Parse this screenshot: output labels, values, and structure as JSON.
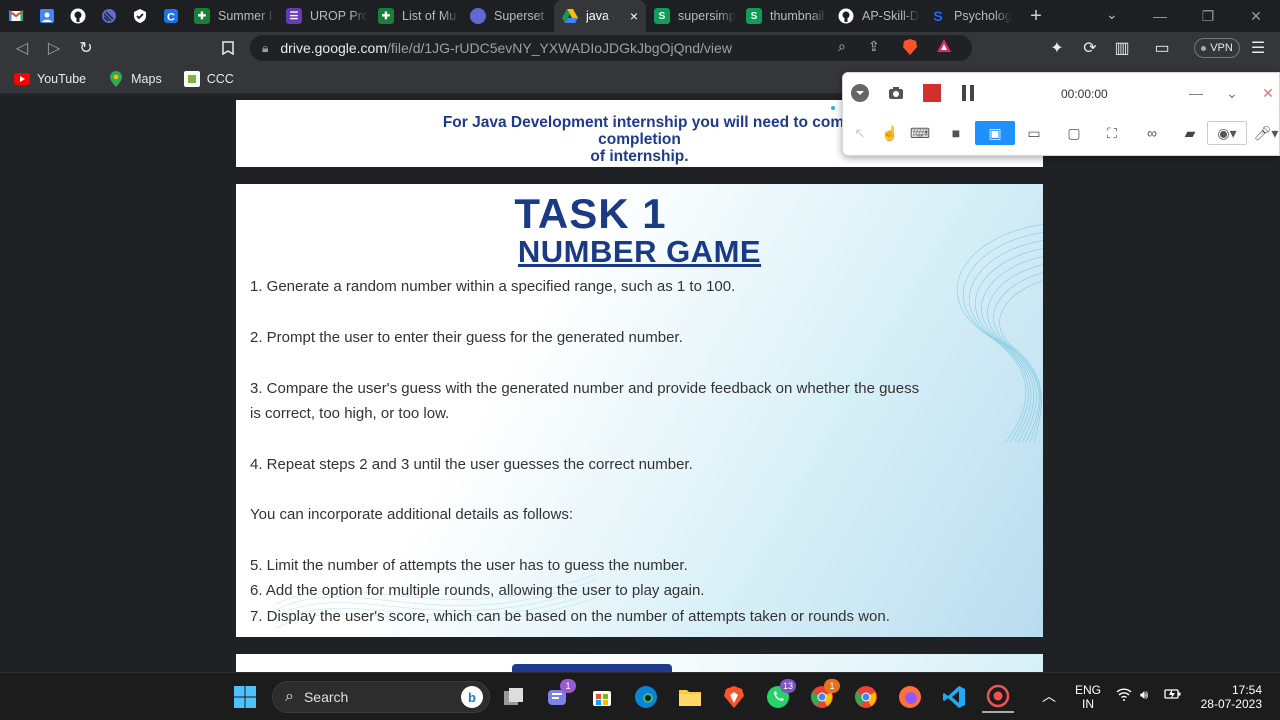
{
  "tabs": {
    "pinned": [
      "gmail-icon",
      "photos-icon",
      "github-icon",
      "linear-icon",
      "check-icon",
      "c-icon"
    ],
    "items": [
      {
        "label": "Summer I",
        "icon": "sheets-icon",
        "color": "#188038"
      },
      {
        "label": "UROP Pro",
        "icon": "forms-icon",
        "color": "#673ab7"
      },
      {
        "label": "List of Mu",
        "icon": "sheets-icon",
        "color": "#188038"
      },
      {
        "label": "Superset",
        "icon": "linear-icon",
        "color": "#5e6ad2"
      },
      {
        "label": "java d",
        "icon": "drive-icon",
        "color": "#fbbc04"
      },
      {
        "label": "supersimp",
        "icon": "s-icon",
        "color": "#0f9d58"
      },
      {
        "label": "thumbnail",
        "icon": "s-icon",
        "color": "#0f9d58"
      },
      {
        "label": "AP-Skill-D",
        "icon": "github-icon",
        "color": "#ffffff"
      },
      {
        "label": "Psycholog",
        "icon": "s-logo-icon",
        "color": "#2962ff"
      }
    ],
    "close_glyph": "×",
    "new_tab_glyph": "+"
  },
  "toolbar": {
    "url_host": "drive.google.com",
    "url_path": "/file/d/1JG-rUDC5evNY_YXWADIoJDGkJbgOjQnd/view",
    "vpn_label": "VPN"
  },
  "bookmarks": [
    {
      "label": "YouTube",
      "icon": "youtube-icon"
    },
    {
      "label": "Maps",
      "icon": "maps-icon"
    },
    {
      "label": "CCC",
      "icon": "ccc-icon"
    }
  ],
  "document": {
    "intro_line1": "For Java Development internship you will need to complete at least 3",
    "intro_line2": "completion",
    "intro_line3": "of internship.",
    "task_title": "TASK 1",
    "task_subtitle": "NUMBER GAME",
    "steps": [
      "1. Generate a random number within a specified range, such as 1 to 100.",
      "2. Prompt the user to enter their guess for the generated number.",
      "3. Compare the user's guess with the generated number and provide feedback on whether the guess",
      "is correct, too high, or too low.",
      "4. Repeat steps 2 and 3 until the user guesses the correct number.",
      "You can incorporate additional details as follows:",
      "5. Limit the number of attempts the user has to guess the number.",
      "6. Add the option for multiple rounds, allowing the user to play again.",
      "7. Display the user's score, which can be based on the number of attempts taken or rounds won."
    ]
  },
  "recorder": {
    "timer": "00:00:00"
  },
  "taskbar": {
    "search_label": "Search",
    "teams_badge": "1",
    "whatsapp_badge": "13",
    "chrome_badge": "1",
    "lang_line1": "ENG",
    "lang_line2": "IN",
    "time": "17:54",
    "date": "28-07-2023"
  }
}
